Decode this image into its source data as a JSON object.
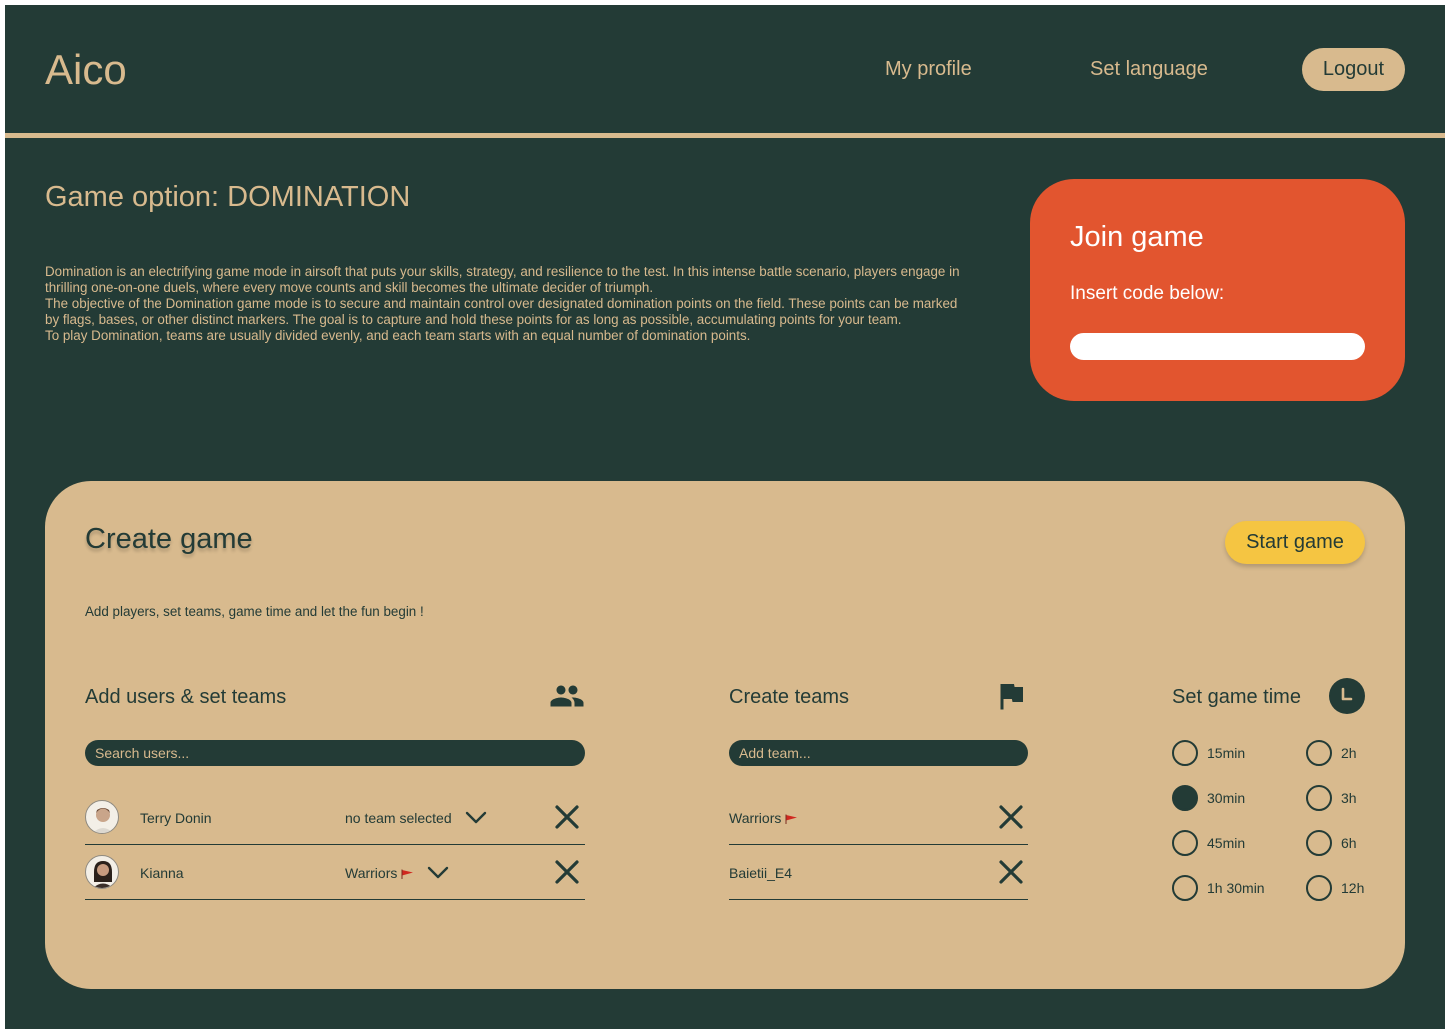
{
  "header": {
    "brand": "Aico",
    "nav": {
      "profile": "My profile",
      "language": "Set language",
      "logout": "Logout"
    }
  },
  "game_option": {
    "title": "Game option: DOMINATION",
    "paragraphs": [
      "Domination is an electrifying game mode in airsoft that puts your skills, strategy, and resilience to the test. In this intense battle scenario, players engage in thrilling one-on-one duels, where every move counts and skill becomes the ultimate decider of triumph.",
      "The objective of the Domination game mode is to secure and maintain control over designated domination points on the field. These points can be marked by flags, bases, or other distinct markers. The goal is to capture and hold these points for as long as possible, accumulating points for your team.",
      "To play Domination, teams are usually divided evenly, and each team starts with an equal number of domination points."
    ]
  },
  "join_game": {
    "title": "Join game",
    "label": "Insert code below:",
    "value": ""
  },
  "create_game": {
    "title": "Create game",
    "start_label": "Start game",
    "subtitle": "Add players, set teams, game time and let the fun begin !",
    "users": {
      "title": "Add users & set teams",
      "icon": "people-icon",
      "search_placeholder": "Search users...",
      "rows": [
        {
          "name": "Terry Donin",
          "team": "no team selected"
        },
        {
          "name": "Kianna",
          "team": "Warriors"
        }
      ]
    },
    "teams": {
      "title": "Create teams",
      "icon": "flag-icon",
      "add_placeholder": "Add team...",
      "rows": [
        {
          "name": "Warriors"
        },
        {
          "name": "Baietii_E4"
        }
      ]
    },
    "time": {
      "title": "Set game time",
      "icon": "clock-icon",
      "options": [
        "15min",
        "30min",
        "45min",
        "1h 30min",
        "2h",
        "3h",
        "6h",
        "12h"
      ],
      "selected": "30min"
    }
  },
  "colors": {
    "background": "#233b36",
    "beige": "#d8ba8e",
    "accent_orange": "#e2552f",
    "start_yellow": "#f5c542",
    "team_flag_red": "#d0281f"
  }
}
